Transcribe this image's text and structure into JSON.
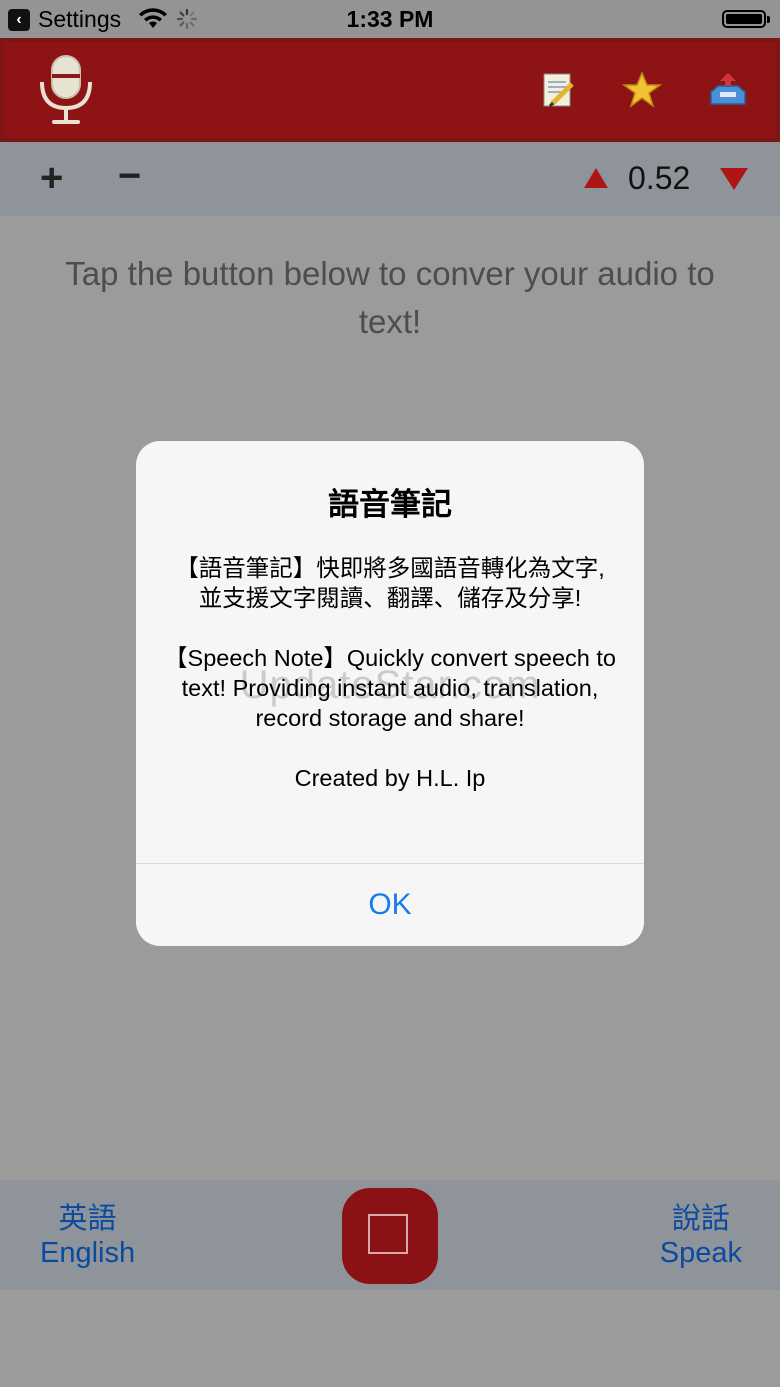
{
  "status_bar": {
    "back_label": "Settings",
    "time": "1:33 PM"
  },
  "toolbar": {
    "logo_icon": "microphone-icon",
    "actions": [
      {
        "icon": "notepad-pencil-icon"
      },
      {
        "icon": "star-icon"
      },
      {
        "icon": "inbox-share-icon"
      }
    ],
    "colors": {
      "background": "#8d1315"
    }
  },
  "controls": {
    "plus": "+",
    "minus": "−",
    "value": "0.52"
  },
  "main": {
    "hint": "Tap the button below to conver your audio to text!"
  },
  "alert": {
    "title": "語音筆記",
    "message_zh": "【語音筆記】快即將多國語音轉化為文字, 並支援文字閱讀、翻譯、儲存及分享!",
    "message_en": "【Speech Note】Quickly convert speech to text! Providing instant audio, translation, record storage and share!",
    "credit": "Created by H.L. Ip",
    "watermark": "UpdateStar.com",
    "ok_label": "OK"
  },
  "bottom_bar": {
    "left_lang_zh": "英語",
    "left_lang_en": "English",
    "right_zh": "說話",
    "right_en": "Speak",
    "accent_color": "#0a4aa1",
    "record_color": "#8b1214"
  }
}
